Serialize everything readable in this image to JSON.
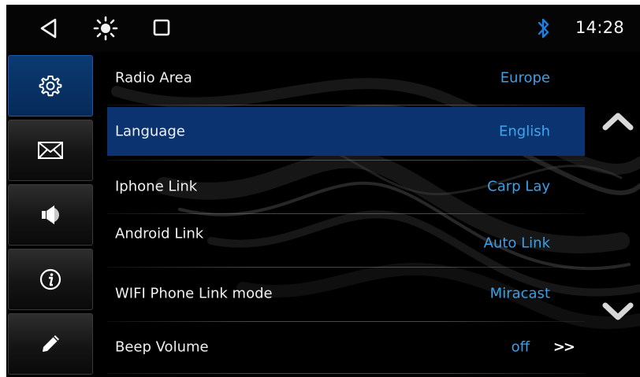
{
  "statusbar": {
    "time": "14:28",
    "icons": [
      "back-triangle-icon",
      "brightness-icon",
      "home-square-icon",
      "bluetooth-icon"
    ]
  },
  "sidebar": {
    "items": [
      {
        "icon": "gear-icon",
        "active": true
      },
      {
        "icon": "envelope-icon",
        "active": false
      },
      {
        "icon": "speaker-icon",
        "active": false
      },
      {
        "icon": "info-icon",
        "active": false
      },
      {
        "icon": "pencil-icon",
        "active": false
      }
    ]
  },
  "settings": {
    "rows": [
      {
        "label": "Radio Area",
        "value": "Europe",
        "selected": false
      },
      {
        "label": "Language",
        "value": "English",
        "selected": true
      },
      {
        "label": "Iphone Link",
        "value": "Carp Lay",
        "selected": false
      },
      {
        "label": "Android Link",
        "value": "Auto Link",
        "selected": false
      },
      {
        "label": "WIFI Phone Link mode",
        "value": "Miracast",
        "selected": false
      },
      {
        "label": "Beep Volume",
        "value": "off",
        "chevron": ">>",
        "selected": false
      }
    ]
  },
  "scroll": {
    "up_icon": "chevron-up-icon",
    "down_icon": "chevron-down-icon"
  },
  "colors": {
    "selected_row": "#0a3370",
    "value_text": "#3aa0e8",
    "active_sidebar": "#0b3a73",
    "bluetooth": "#1e7fe0"
  }
}
